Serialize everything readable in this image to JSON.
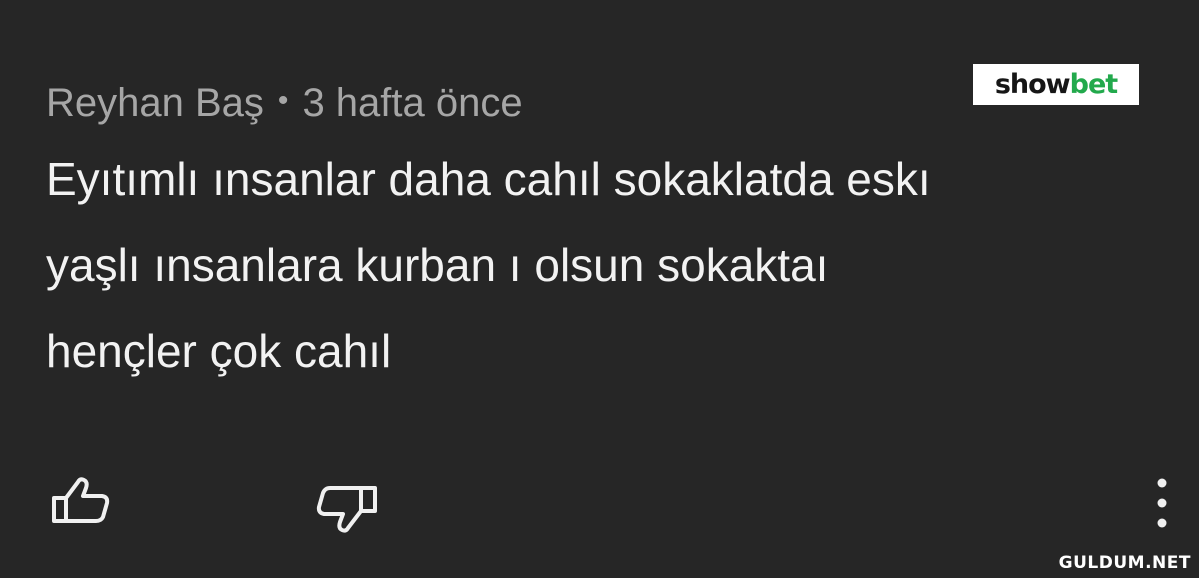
{
  "comment": {
    "author": "Reyhan Baş",
    "separator": "•",
    "time": "3 hafta önce",
    "text_lines": [
      "Eyıtımlı ınsanlar daha cahıl sokaklatda eskı",
      "yaşlı ınsanlara kurban ı olsun sokaktaı",
      "hençler çok cahıl"
    ]
  },
  "logo": {
    "part_a": "show",
    "part_b": "bet",
    "colors": {
      "part_a": "#161616",
      "part_b": "#22a94c"
    }
  },
  "actions": {
    "like_icon": "thumbs-up-icon",
    "dislike_icon": "thumbs-down-icon",
    "more_icon": "vertical-ellipsis-icon"
  },
  "watermark": "GULDUM.NET",
  "colors": {
    "background": "#262626",
    "meta_text": "#a6a6a6",
    "body_text": "#f2f2f2"
  }
}
